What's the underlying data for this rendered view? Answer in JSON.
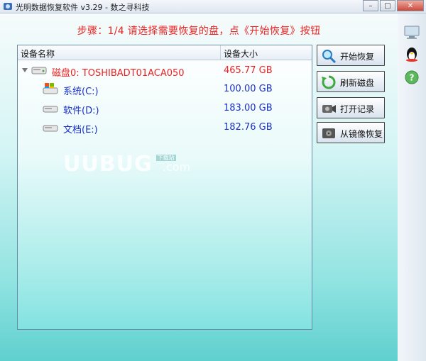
{
  "window": {
    "title": "光明数据恢复软件 v3.29 - 数之寻科技",
    "buttons": {
      "minimize": "–",
      "maximize": "□",
      "close": "✕"
    }
  },
  "step": {
    "text": "步骤：1/4 请选择需要恢复的盘，点《开始恢复》按钮"
  },
  "list": {
    "headers": {
      "name": "设备名称",
      "size": "设备大小"
    },
    "rows": [
      {
        "name": "磁盘0: TOSHIBADT01ACA050",
        "size": "465.77 GB",
        "kind": "disk"
      },
      {
        "name": "系统(C:)",
        "size": "100.00 GB",
        "kind": "partition"
      },
      {
        "name": "软件(D:)",
        "size": "183.00 GB",
        "kind": "partition"
      },
      {
        "name": "文档(E:)",
        "size": "182.76 GB",
        "kind": "partition"
      }
    ]
  },
  "actions": {
    "start": "开始恢复",
    "refresh": "刷新磁盘",
    "open_record": "打开记录",
    "restore_image": "从镜像恢复"
  },
  "watermark": {
    "main": "UUBUG",
    "tag": "下载站",
    "suffix": ".com"
  }
}
